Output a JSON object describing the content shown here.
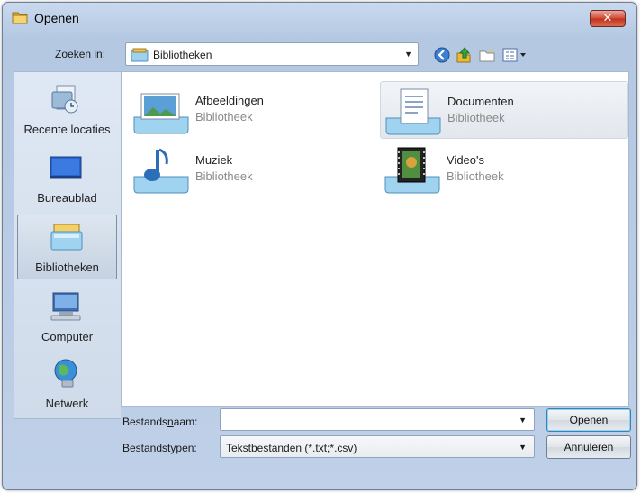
{
  "window": {
    "title": "Openen"
  },
  "lookin": {
    "label": "Zoeken in:",
    "value": "Bibliotheken"
  },
  "places": [
    {
      "label": "Recente locaties",
      "icon": "recent-locations-icon"
    },
    {
      "label": "Bureaublad",
      "icon": "desktop-icon"
    },
    {
      "label": "Bibliotheken",
      "icon": "libraries-icon",
      "selected": true
    },
    {
      "label": "Computer",
      "icon": "computer-icon"
    },
    {
      "label": "Netwerk",
      "icon": "network-icon"
    }
  ],
  "items": [
    {
      "name": "Afbeeldingen",
      "type": "Bibliotheek",
      "icon": "pictures-library-icon"
    },
    {
      "name": "Documenten",
      "type": "Bibliotheek",
      "icon": "documents-library-icon",
      "selected": true
    },
    {
      "name": "Muziek",
      "type": "Bibliotheek",
      "icon": "music-library-icon"
    },
    {
      "name": "Video's",
      "type": "Bibliotheek",
      "icon": "videos-library-icon"
    }
  ],
  "filename": {
    "label": "Bestandsnaam:",
    "value": ""
  },
  "filetype": {
    "label": "Bestandstypen:",
    "value": "Tekstbestanden (*.txt;*.csv)"
  },
  "buttons": {
    "open": "Openen",
    "cancel": "Annuleren"
  },
  "colors": {
    "title_bar": "#bfd0e8",
    "close": "#d24b34",
    "selection": "#e2e7ee"
  }
}
